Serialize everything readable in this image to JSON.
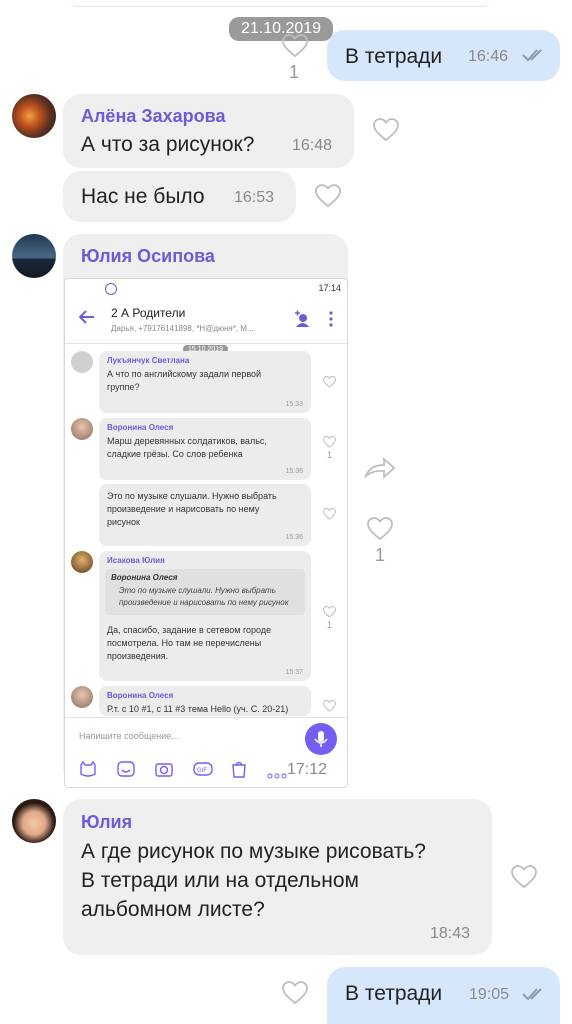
{
  "date_badge": "21.10.2019",
  "messages": [
    {
      "text": "В тетради",
      "time": "16:46",
      "likes": "1"
    },
    {
      "sender": "Алёна Захарова",
      "text": "А что за рисунок?",
      "time": "16:48"
    },
    {
      "text": "Нас не было",
      "time": "16:53"
    },
    {
      "sender": "Юлия Осипова",
      "time": "17:12",
      "likes": "1"
    },
    {
      "sender": "Юлия",
      "text_lines": [
        "А где рисунок по музыке рисовать?",
        "В тетради или на отдельном",
        "альбомном листе?"
      ],
      "time": "18:43"
    },
    {
      "text": "В тетради",
      "time": "19:05"
    }
  ],
  "screenshot": {
    "clock": "17:14",
    "group_title": "2 А Родители",
    "group_members": "Дарья, +79176141898, *Н@дюня*, М...",
    "date_badge": "15.10.2019",
    "items": [
      {
        "name": "Лукъянчук Светлана",
        "lines": [
          "А что по английскому задали первой",
          "группе?"
        ],
        "time": "15:33"
      },
      {
        "name": "Воронина Олеся",
        "lines": [
          "Марш деревянных солдатиков, вальс,",
          "сладкие грёзы. Со слов ребенка"
        ],
        "time": "15:36",
        "likes": "1"
      },
      {
        "lines": [
          "Это по музыке слушали. Нужно выбрать",
          "произведение и нарисовать по нему",
          "рисунок"
        ],
        "time": "15:36"
      },
      {
        "name": "Исакова Юлия",
        "quote_name": "Воронина Олеся",
        "quote_lines": [
          "Это по музыке слушали. Нужно выбрать",
          "произведение и нарисовать по нему рисунок"
        ],
        "lines": [
          "Да, спасибо, задание в сетевом городе",
          "посмотрела. Но там не перечислены",
          "произведения."
        ],
        "time": "15:37",
        "likes": "1"
      },
      {
        "name": "Воронина Олеся",
        "lines": [
          "Р.т. с 10 #1, с 11 #3 тема Hello (уч. С. 20-21)"
        ]
      }
    ],
    "input_placeholder": "Напишите сообщение..."
  }
}
